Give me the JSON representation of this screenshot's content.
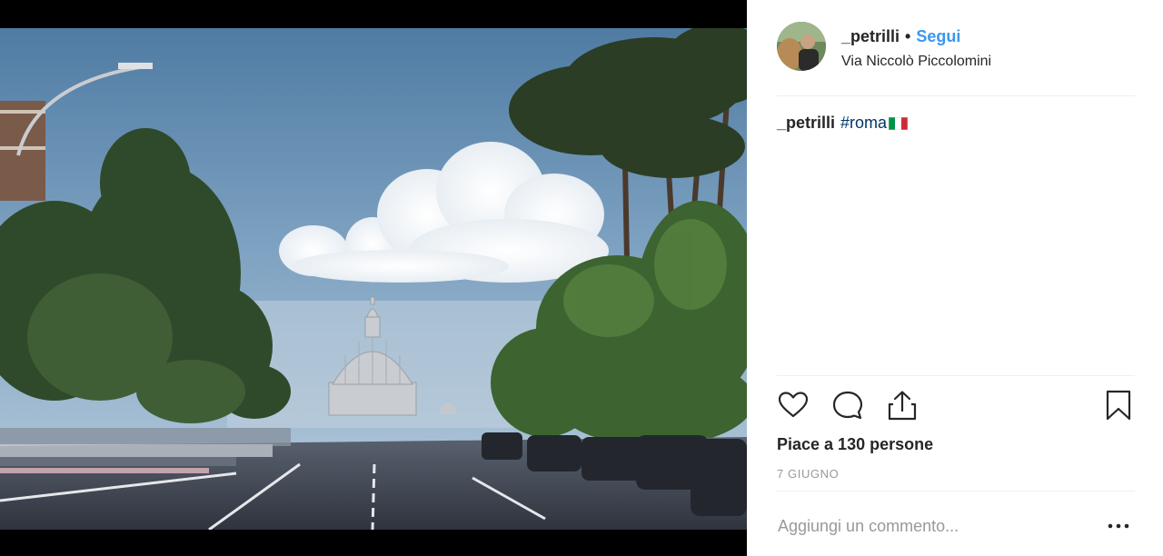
{
  "post": {
    "image_alt": "Via Niccolò Piccolomini, Roma",
    "author": {
      "username": "_petrilli",
      "separator": "•",
      "follow_label": "Segui",
      "location": "Via Niccolò Piccolomini"
    },
    "caption": {
      "username": "_petrilli",
      "hashtag": "#roma",
      "emoji_icon": "italian-flag-icon"
    },
    "actions": {
      "like_icon": "heart-icon",
      "comment_icon": "comment-bubble-icon",
      "share_icon": "share-upload-icon",
      "save_icon": "bookmark-icon"
    },
    "likes_text": "Piace a 130 persone",
    "date_text": "7 GIUGNO",
    "comment_placeholder": "Aggiungi un commento...",
    "more_icon": "ellipsis-icon"
  },
  "colors": {
    "accent": "#3897f0",
    "hashtag": "#003569",
    "muted": "#999999",
    "text": "#262626",
    "divider": "#efefef"
  }
}
